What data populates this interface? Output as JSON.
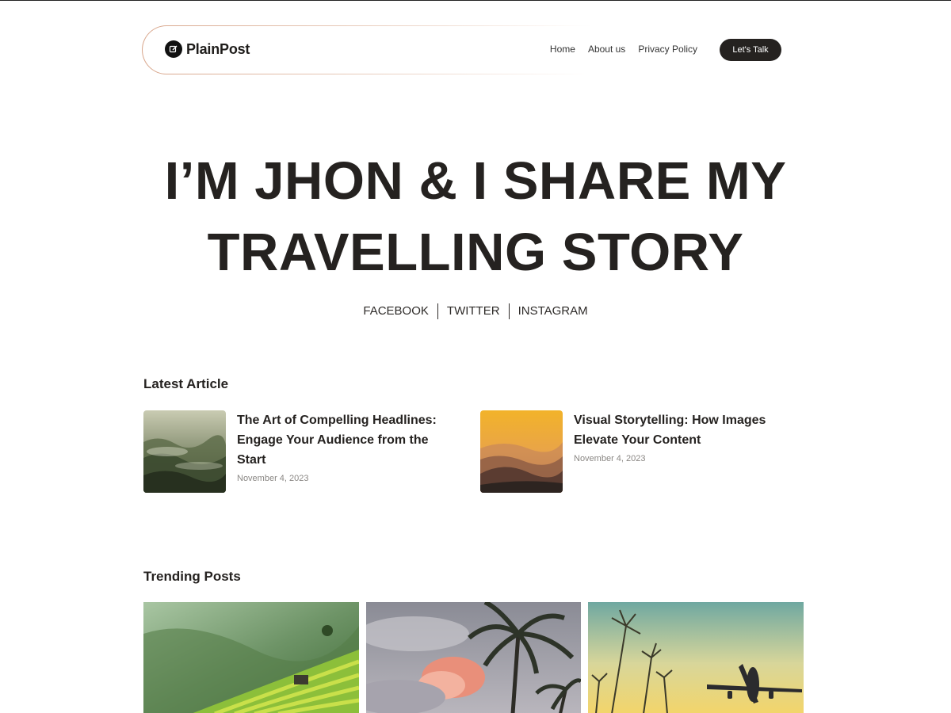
{
  "header": {
    "logo_text": "PlainPost",
    "nav": [
      "Home",
      "About us",
      "Privacy Policy"
    ],
    "cta_label": "Let's Talk"
  },
  "hero": {
    "title_line1": "I’M JHON & I SHARE MY",
    "title_line2": "TRAVELLING STORY",
    "socials": [
      "FACEBOOK",
      "TWITTER",
      "INSTAGRAM"
    ]
  },
  "latest": {
    "heading": "Latest Article",
    "articles": [
      {
        "title": "The Art of Compelling Headlines: Engage Your Audience from the Start",
        "date": "November 4, 2023",
        "image": "misty-forest-hills"
      },
      {
        "title": "Visual Storytelling: How Images Elevate Your Content",
        "date": "November 4, 2023",
        "image": "golden-sunset-mountains"
      }
    ]
  },
  "trending": {
    "heading": "Trending Posts",
    "posts": [
      {
        "image": "rice-terraces"
      },
      {
        "image": "palm-trees-sunset-clouds"
      },
      {
        "image": "airplane-over-grass"
      }
    ]
  },
  "colors": {
    "text": "#252220",
    "cta_bg": "#252220",
    "header_border": "#d8a58a",
    "muted": "#8a8784"
  }
}
